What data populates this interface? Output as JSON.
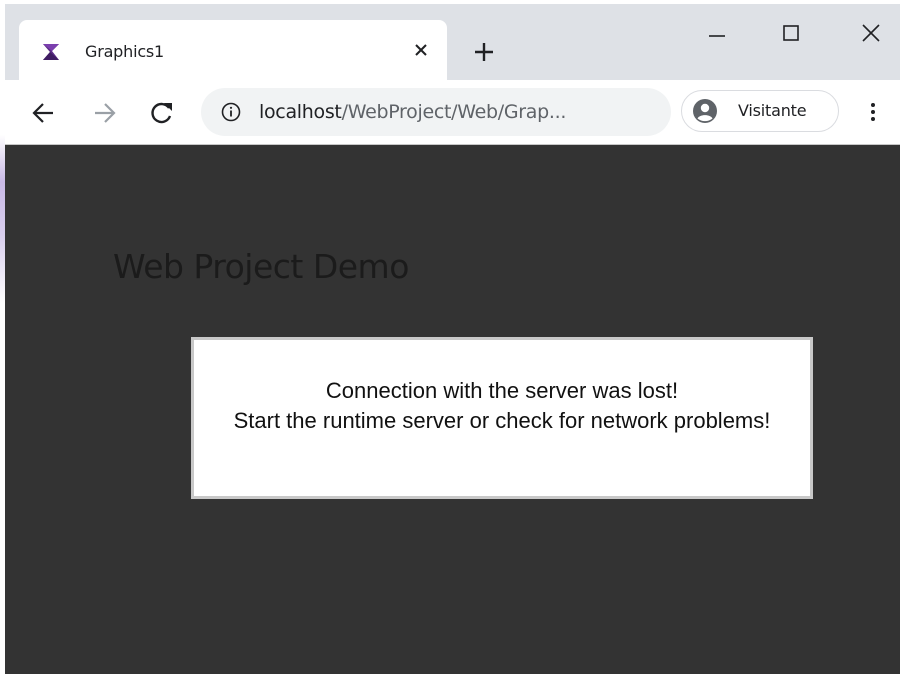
{
  "browser": {
    "tab": {
      "title": "Graphics1",
      "favicon": "app-logo-icon",
      "close_icon": "close-icon"
    },
    "new_tab_icon": "plus-icon",
    "window_controls": [
      "minimize-icon",
      "maximize-icon",
      "close-icon"
    ],
    "toolbar": {
      "back_icon": "arrow-left-icon",
      "forward_icon": "arrow-right-icon",
      "reload_icon": "reload-icon",
      "site_info_icon": "info-icon",
      "url_host": "localhost",
      "url_path": "/WebProject/Web/Grap...",
      "profile_label": "Visitante",
      "menu_icon": "kebab-menu-icon"
    }
  },
  "page": {
    "title": "Web Project Demo",
    "dialog": {
      "line1": "Connection with the server was lost!",
      "line2": "Start the runtime server or check for network problems!"
    }
  },
  "colors": {
    "page_background": "#333333",
    "tabstrip": "#dee1e6",
    "dialog_background": "#ffffff",
    "dialog_border": "#c8c8c8"
  }
}
